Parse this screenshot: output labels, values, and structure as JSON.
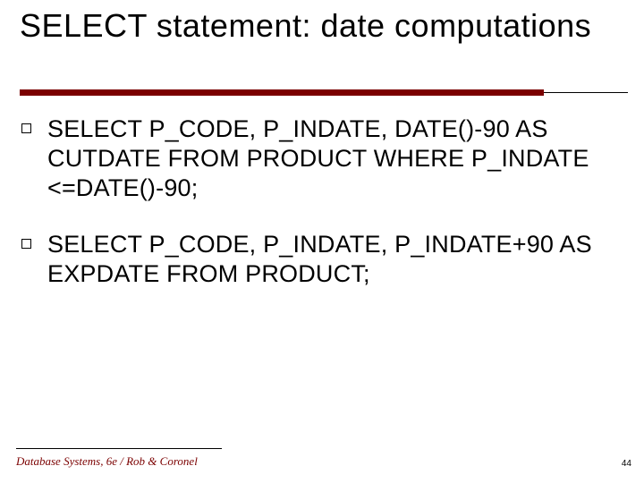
{
  "title": "SELECT statement: date computations",
  "bullets": [
    "SELECT P_CODE, P_INDATE, DATE()-90 AS CUTDATE FROM PRODUCT WHERE P_INDATE <=DATE()-90;",
    "SELECT P_CODE, P_INDATE, P_INDATE+90 AS EXPDATE FROM PRODUCT;"
  ],
  "footer": "Database Systems, 6e / Rob & Coronel",
  "page_number": "44"
}
